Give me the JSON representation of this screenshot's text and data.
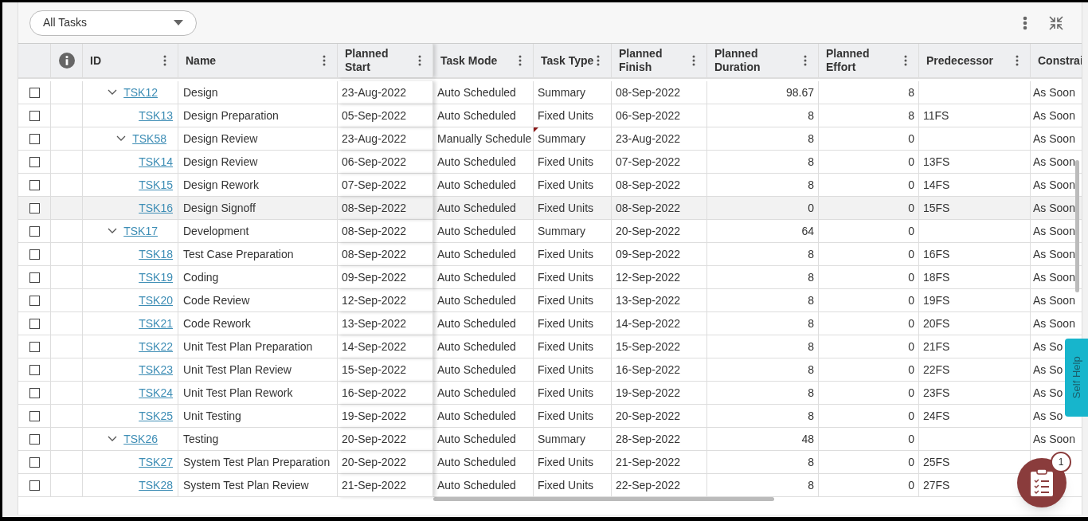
{
  "filter": {
    "value": "All Tasks"
  },
  "columns": [
    {
      "label": "ID"
    },
    {
      "label": "Name"
    },
    {
      "label": "Planned Start",
      "kind": "text",
      "two_line": true
    },
    {
      "label": "Task Mode",
      "kind": "text",
      "two_line": false
    },
    {
      "label": "Task Type",
      "kind": "text",
      "two_line": false
    },
    {
      "label": "Planned Finish",
      "kind": "text",
      "two_line": true
    },
    {
      "label": "Planned Duration",
      "kind": "number",
      "two_line": true
    },
    {
      "label": "Planned Effort",
      "kind": "number",
      "two_line": true
    },
    {
      "label": "Predecessor",
      "kind": "text"
    },
    {
      "label": "Constrai",
      "kind": "text"
    }
  ],
  "rows": [
    {
      "id": "TSK12",
      "name": "Design",
      "start": "23-Aug-2022",
      "mode": "Auto Scheduled",
      "type": "Summary",
      "finish": "08-Sep-2022",
      "duration": "98.67",
      "effort": "8",
      "constraint": "As Soon",
      "checked": false,
      "hovered": false,
      "flagged": false,
      "expanded": true,
      "children": [
        {
          "id": "TSK13",
          "name": "Design Preparation",
          "start": "05-Sep-2022",
          "mode": "Auto Scheduled",
          "type": "Fixed Units",
          "finish": "06-Sep-2022",
          "duration": "8",
          "effort": "8",
          "predecessor": "11FS",
          "constraint": "As Soon",
          "checked": false,
          "hovered": false,
          "flagged": false
        },
        {
          "id": "TSK58",
          "name": "Design Review",
          "start": "23-Aug-2022",
          "mode": "Manually Schedule",
          "type": "Summary",
          "finish": "23-Aug-2022",
          "duration": "8",
          "effort": "0",
          "constraint": "As Soon",
          "checked": false,
          "hovered": false,
          "flagged": true,
          "expanded": true,
          "children": [
            {
              "id": "TSK14",
              "name": "Design Review",
              "start": "06-Sep-2022",
              "mode": "Auto Scheduled",
              "type": "Fixed Units",
              "finish": "07-Sep-2022",
              "duration": "8",
              "effort": "0",
              "predecessor": "13FS",
              "constraint": "As Soon",
              "checked": false,
              "hovered": false,
              "flagged": false
            },
            {
              "id": "TSK15",
              "name": "Design Rework",
              "start": "07-Sep-2022",
              "mode": "Auto Scheduled",
              "type": "Fixed Units",
              "finish": "08-Sep-2022",
              "duration": "8",
              "effort": "0",
              "predecessor": "14FS",
              "constraint": "As Soon",
              "checked": false,
              "hovered": false,
              "flagged": false
            },
            {
              "id": "TSK16",
              "name": "Design Signoff",
              "start": "08-Sep-2022",
              "mode": "Auto Scheduled",
              "type": "Fixed Units",
              "finish": "08-Sep-2022",
              "duration": "0",
              "effort": "0",
              "predecessor": "15FS",
              "constraint": "As Soon",
              "checked": false,
              "hovered": true,
              "flagged": false
            }
          ]
        }
      ]
    },
    {
      "id": "TSK17",
      "name": "Development",
      "start": "08-Sep-2022",
      "mode": "Auto Scheduled",
      "type": "Summary",
      "finish": "20-Sep-2022",
      "duration": "64",
      "effort": "0",
      "constraint": "As Soon",
      "checked": false,
      "hovered": false,
      "flagged": false,
      "expanded": true,
      "children": [
        {
          "id": "TSK18",
          "name": "Test Case Preparation",
          "start": "08-Sep-2022",
          "mode": "Auto Scheduled",
          "type": "Fixed Units",
          "finish": "09-Sep-2022",
          "duration": "8",
          "effort": "0",
          "predecessor": "16FS",
          "constraint": "As Soon",
          "checked": false,
          "hovered": false,
          "flagged": false
        },
        {
          "id": "TSK19",
          "name": "Coding",
          "start": "09-Sep-2022",
          "mode": "Auto Scheduled",
          "type": "Fixed Units",
          "finish": "12-Sep-2022",
          "duration": "8",
          "effort": "0",
          "predecessor": "18FS",
          "constraint": "As Soon",
          "checked": false,
          "hovered": false,
          "flagged": false
        },
        {
          "id": "TSK20",
          "name": "Code Review",
          "start": "12-Sep-2022",
          "mode": "Auto Scheduled",
          "type": "Fixed Units",
          "finish": "13-Sep-2022",
          "duration": "8",
          "effort": "0",
          "predecessor": "19FS",
          "constraint": "As Soon",
          "checked": false,
          "hovered": false,
          "flagged": false
        },
        {
          "id": "TSK21",
          "name": "Code Rework",
          "start": "13-Sep-2022",
          "mode": "Auto Scheduled",
          "type": "Fixed Units",
          "finish": "14-Sep-2022",
          "duration": "8",
          "effort": "0",
          "predecessor": "20FS",
          "constraint": "As Soon",
          "checked": false,
          "hovered": false,
          "flagged": false
        },
        {
          "id": "TSK22",
          "name": "Unit Test Plan Preparation",
          "start": "14-Sep-2022",
          "mode": "Auto Scheduled",
          "type": "Fixed Units",
          "finish": "15-Sep-2022",
          "duration": "8",
          "effort": "0",
          "predecessor": "21FS",
          "constraint": "As So",
          "checked": false,
          "hovered": false,
          "flagged": false
        },
        {
          "id": "TSK23",
          "name": "Unit Test Plan Review",
          "start": "15-Sep-2022",
          "mode": "Auto Scheduled",
          "type": "Fixed Units",
          "finish": "16-Sep-2022",
          "duration": "8",
          "effort": "0",
          "predecessor": "22FS",
          "constraint": "As So",
          "checked": false,
          "hovered": false,
          "flagged": false
        },
        {
          "id": "TSK24",
          "name": "Unit Test Plan Rework",
          "start": "16-Sep-2022",
          "mode": "Auto Scheduled",
          "type": "Fixed Units",
          "finish": "19-Sep-2022",
          "duration": "8",
          "effort": "0",
          "predecessor": "23FS",
          "constraint": "As So",
          "checked": false,
          "hovered": false,
          "flagged": false
        },
        {
          "id": "TSK25",
          "name": "Unit Testing",
          "start": "19-Sep-2022",
          "mode": "Auto Scheduled",
          "type": "Fixed Units",
          "finish": "20-Sep-2022",
          "duration": "8",
          "effort": "0",
          "predecessor": "24FS",
          "constraint": "As So",
          "checked": false,
          "hovered": false,
          "flagged": false
        }
      ]
    },
    {
      "id": "TSK26",
      "name": "Testing",
      "start": "20-Sep-2022",
      "mode": "Auto Scheduled",
      "type": "Summary",
      "finish": "28-Sep-2022",
      "duration": "48",
      "effort": "0",
      "constraint": "As Soon",
      "checked": false,
      "hovered": false,
      "flagged": false,
      "expanded": true,
      "children": [
        {
          "id": "TSK27",
          "name": "System Test Plan Preparation",
          "start": "20-Sep-2022",
          "mode": "Auto Scheduled",
          "type": "Fixed Units",
          "finish": "21-Sep-2022",
          "duration": "8",
          "effort": "0",
          "predecessor": "25FS",
          "checked": false,
          "hovered": false,
          "flagged": false
        },
        {
          "id": "TSK28",
          "name": "System Test Plan Review",
          "start": "21-Sep-2022",
          "mode": "Auto Scheduled",
          "type": "Fixed Units",
          "finish": "22-Sep-2022",
          "duration": "8",
          "effort": "0",
          "predecessor": "27FS",
          "checked": false,
          "hovered": false,
          "flagged": false
        }
      ]
    }
  ],
  "self_help": {
    "label": "Self Help"
  },
  "tasks_badge": {
    "count": "1"
  }
}
